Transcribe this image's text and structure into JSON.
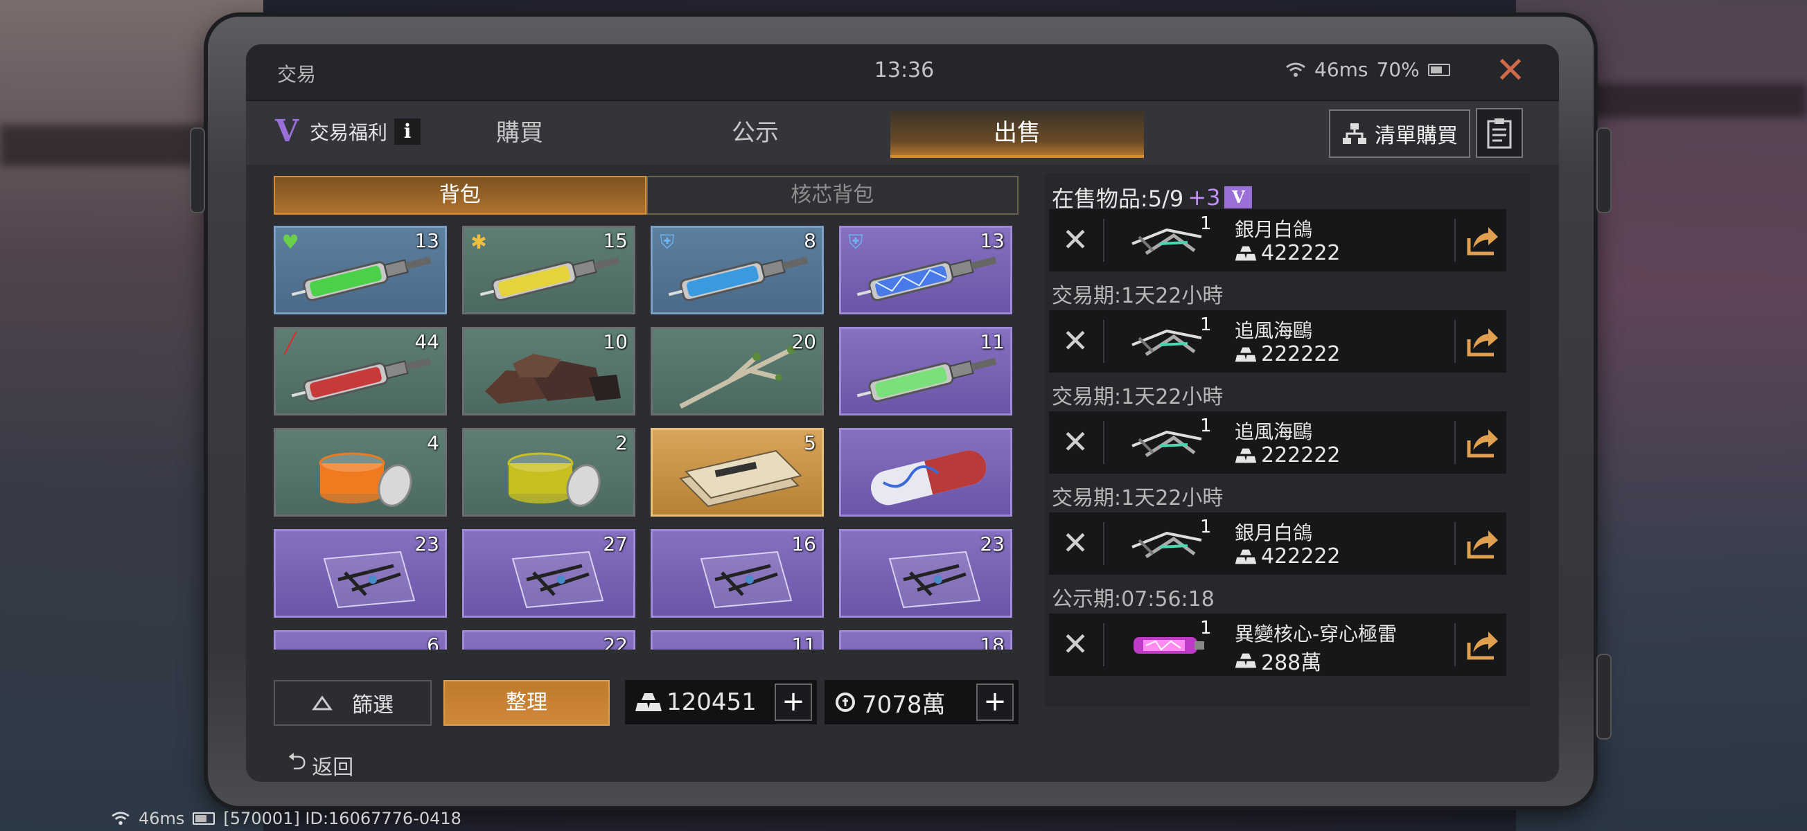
{
  "window": {
    "title": "交易",
    "clock": "13:36",
    "ping": "46ms",
    "battery": "70%"
  },
  "tabs": {
    "benefit_label": "交易福利",
    "info_icon": "i",
    "items": [
      {
        "label": "購買",
        "active": false
      },
      {
        "label": "公示",
        "active": false
      },
      {
        "label": "出售",
        "active": true
      }
    ],
    "list_buy_label": "清單購買"
  },
  "inventory": {
    "subtabs": [
      {
        "label": "背包",
        "active": true
      },
      {
        "label": "核芯背包",
        "active": false
      }
    ],
    "items": [
      {
        "icon": "green-syringe-icon",
        "color": "blue",
        "count": "13",
        "badge": "heart"
      },
      {
        "icon": "yellow-syringe-icon",
        "color": "green",
        "count": "15",
        "badge": "snow"
      },
      {
        "icon": "blue-syringe-icon",
        "color": "blue",
        "count": "8",
        "badge": "shield"
      },
      {
        "icon": "electric-syringe-icon",
        "color": "purple",
        "count": "13",
        "badge": "shield"
      },
      {
        "icon": "red-syringe-icon",
        "color": "green",
        "count": "44",
        "badge": "syringe"
      },
      {
        "icon": "ore-icon",
        "color": "green",
        "count": "10",
        "badge": ""
      },
      {
        "icon": "branch-icon",
        "color": "green",
        "count": "20",
        "badge": ""
      },
      {
        "icon": "small-syringe-icon",
        "color": "purple",
        "count": "11",
        "badge": ""
      },
      {
        "icon": "orange-jar-icon",
        "color": "green",
        "count": "4",
        "badge": ""
      },
      {
        "icon": "yellow-jar-icon",
        "color": "green",
        "count": "2",
        "badge": ""
      },
      {
        "icon": "documents-icon",
        "color": "gold",
        "count": "5",
        "badge": ""
      },
      {
        "icon": "capsule-icon",
        "color": "purple",
        "count": "",
        "badge": ""
      },
      {
        "icon": "blueprint-icon",
        "color": "purple",
        "count": "23",
        "badge": ""
      },
      {
        "icon": "blueprint-icon",
        "color": "purple",
        "count": "27",
        "badge": ""
      },
      {
        "icon": "blueprint-icon",
        "color": "purple",
        "count": "16",
        "badge": ""
      },
      {
        "icon": "blueprint-icon",
        "color": "purple",
        "count": "23",
        "badge": ""
      },
      {
        "icon": "blueprint-icon",
        "color": "purple",
        "count": "6",
        "badge": ""
      },
      {
        "icon": "blueprint-icon",
        "color": "purple",
        "count": "22",
        "badge": ""
      },
      {
        "icon": "blueprint-icon",
        "color": "purple",
        "count": "11",
        "badge": ""
      },
      {
        "icon": "blueprint-icon",
        "color": "purple",
        "count": "18",
        "badge": ""
      }
    ],
    "filter_label": "篩選",
    "sort_label": "整理",
    "gold_amount": "120451",
    "coin_amount": "7078萬",
    "back_label": "返回"
  },
  "selling": {
    "header_prefix": "在售物品:5/9",
    "header_bonus": "+3",
    "v_badge": "V",
    "rows": [
      {
        "name": "銀月白鴿",
        "qty": "1",
        "price": "422222",
        "icon": "crossbow-icon",
        "period": ""
      },
      {
        "name": "追風海鷗",
        "qty": "1",
        "price": "222222",
        "icon": "crossbow-icon",
        "period": "交易期:1天22小時"
      },
      {
        "name": "追風海鷗",
        "qty": "1",
        "price": "222222",
        "icon": "crossbow-icon",
        "period": "交易期:1天22小時"
      },
      {
        "name": "銀月白鴿",
        "qty": "1",
        "price": "422222",
        "icon": "crossbow-icon",
        "period": "交易期:1天22小時"
      },
      {
        "name": "異變核心-穿心極雷",
        "qty": "1",
        "price": "288萬",
        "icon": "core-icon",
        "period": "公示期:07:56:18"
      }
    ]
  },
  "debug": {
    "ping": "46ms",
    "id": "[570001] ID:16067776-0418"
  },
  "colors": {
    "accent": "#d88c34",
    "vip": "#9a6fd8",
    "close": "#d06a4a"
  }
}
